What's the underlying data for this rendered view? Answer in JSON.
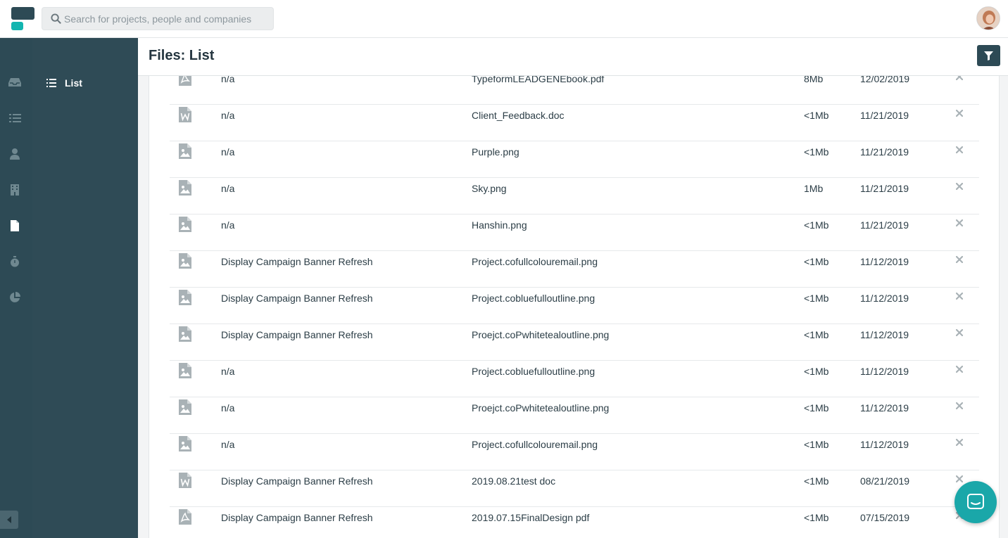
{
  "search": {
    "placeholder": "Search for projects, people and companies"
  },
  "subnav": {
    "list_label": "List"
  },
  "header": {
    "title": "Files: List"
  },
  "colors": {
    "sidebar": "#2d4a55",
    "accent": "#13b5b0",
    "chat": "#1aa7a9"
  },
  "files": [
    {
      "icon": "pdf-file-icon",
      "project": "n/a",
      "name": "TypeformLEADGENEbook.pdf",
      "size": "8Mb",
      "date": "12/02/2019"
    },
    {
      "icon": "word-file-icon",
      "project": "n/a",
      "name": "Client_Feedback.doc",
      "size": "<1Mb",
      "date": "11/21/2019"
    },
    {
      "icon": "image-file-icon",
      "project": "n/a",
      "name": "Purple.png",
      "size": "<1Mb",
      "date": "11/21/2019"
    },
    {
      "icon": "image-file-icon",
      "project": "n/a",
      "name": "Sky.png",
      "size": "1Mb",
      "date": "11/21/2019"
    },
    {
      "icon": "image-file-icon",
      "project": "n/a",
      "name": "Hanshin.png",
      "size": "<1Mb",
      "date": "11/21/2019"
    },
    {
      "icon": "image-file-icon",
      "project": "Display Campaign Banner Refresh",
      "name": "Project.cofullcolouremail.png",
      "size": "<1Mb",
      "date": "11/12/2019"
    },
    {
      "icon": "image-file-icon",
      "project": "Display Campaign Banner Refresh",
      "name": "Project.cobluefulloutline.png",
      "size": "<1Mb",
      "date": "11/12/2019"
    },
    {
      "icon": "image-file-icon",
      "project": "Display Campaign Banner Refresh",
      "name": "Proejct.coPwhitetealoutline.png",
      "size": "<1Mb",
      "date": "11/12/2019"
    },
    {
      "icon": "image-file-icon",
      "project": "n/a",
      "name": "Project.cobluefulloutline.png",
      "size": "<1Mb",
      "date": "11/12/2019"
    },
    {
      "icon": "image-file-icon",
      "project": "n/a",
      "name": "Proejct.coPwhitetealoutline.png",
      "size": "<1Mb",
      "date": "11/12/2019"
    },
    {
      "icon": "image-file-icon",
      "project": "n/a",
      "name": "Project.cofullcolouremail.png",
      "size": "<1Mb",
      "date": "11/12/2019"
    },
    {
      "icon": "word-file-icon",
      "project": "Display Campaign Banner Refresh",
      "name": "2019.08.21test doc",
      "size": "<1Mb",
      "date": "08/21/2019"
    },
    {
      "icon": "pdf-file-icon",
      "project": "Display Campaign Banner Refresh",
      "name": "2019.07.15FinalDesign pdf",
      "size": "<1Mb",
      "date": "07/15/2019"
    }
  ]
}
